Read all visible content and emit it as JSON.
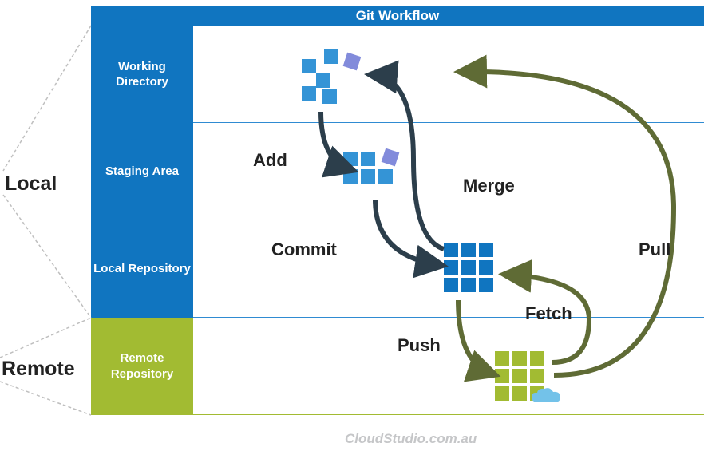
{
  "title": "Git Workflow",
  "sections": {
    "local": "Local",
    "remote": "Remote"
  },
  "rows": {
    "working": "Working Directory",
    "staging": "Staging Area",
    "localrepo": "Local Repository",
    "remoterepo": "Remote Repository"
  },
  "actions": {
    "add": "Add",
    "commit": "Commit",
    "push": "Push",
    "fetch": "Fetch",
    "merge": "Merge",
    "pull": "Pull"
  },
  "watermark": "CloudStudio.com.au",
  "colors": {
    "blue": "#1075c0",
    "green": "#a2bb32",
    "arrow_dark": "#2c3e4b",
    "arrow_olive": "#5f6b35"
  }
}
